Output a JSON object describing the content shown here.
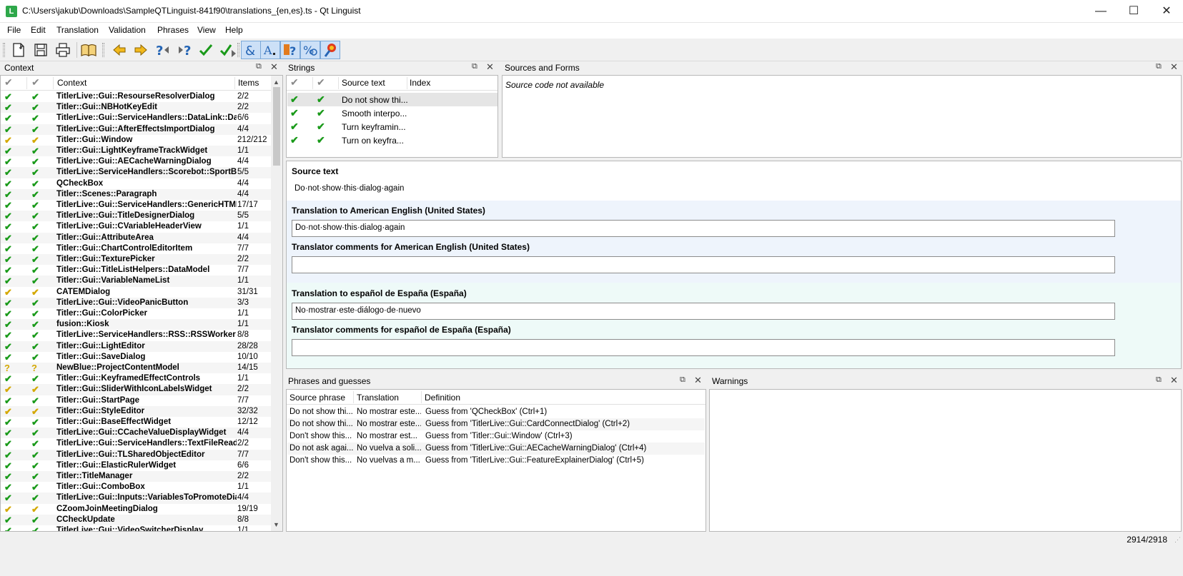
{
  "window": {
    "title": "C:\\Users\\jakub\\Downloads\\SampleQTLinguist-841f90\\translations_{en,es}.ts - Qt Linguist",
    "app_icon_letter": "L",
    "minimize": "—",
    "maximize": "☐",
    "close": "✕"
  },
  "menu": [
    "File",
    "Edit",
    "Translation",
    "Validation",
    "Phrases",
    "View",
    "Help"
  ],
  "toolbar_icons": [
    "open-icon",
    "save-icon",
    "print-icon",
    "phrasebook-icon",
    "prev-icon",
    "next-icon",
    "prev-unfinished-icon",
    "next-unfinished-icon",
    "done-icon",
    "done-and-next-icon",
    "accelerators-icon",
    "ending-punctuation-icon",
    "phrase-matches-icon",
    "place-markers-icon",
    "surrounding-whitespace-icon"
  ],
  "context_panel": {
    "title": "Context",
    "headers": {
      "context": "Context",
      "items": "Items"
    },
    "rows": [
      {
        "name": "TitlerLive::Gui::ResourseResolverDialog",
        "items": "2/2",
        "status": "g"
      },
      {
        "name": "Titler::Gui::NBHotKeyEdit",
        "items": "2/2",
        "status": "g"
      },
      {
        "name": "TitlerLive::Gui::ServiceHandlers::DataLink::Datal",
        "items": "6/6",
        "status": "g"
      },
      {
        "name": "TitlerLive::Gui::AfterEffectsImportDialog",
        "items": "4/4",
        "status": "g"
      },
      {
        "name": "Titler::Gui::Window",
        "items": "212/212",
        "status": "y"
      },
      {
        "name": "Titler::Gui::LightKeyframeTrackWidget",
        "items": "1/1",
        "status": "g"
      },
      {
        "name": "TitlerLive::Gui::AECacheWarningDialog",
        "items": "4/4",
        "status": "g"
      },
      {
        "name": "TitlerLive::ServiceHandlers::Scorebot::SportBot",
        "items": "5/5",
        "status": "g"
      },
      {
        "name": "QCheckBox",
        "items": "4/4",
        "status": "g"
      },
      {
        "name": "Titler::Scenes::Paragraph",
        "items": "4/4",
        "status": "g"
      },
      {
        "name": "TitlerLive::Gui::ServiceHandlers::GenericHTML::",
        "items": "17/17",
        "status": "g"
      },
      {
        "name": "TitlerLive::Gui::TitleDesignerDialog",
        "items": "5/5",
        "status": "g"
      },
      {
        "name": "TitlerLive::Gui::CVariableHeaderView",
        "items": "1/1",
        "status": "g"
      },
      {
        "name": "Titler::Gui::AttributeArea",
        "items": "4/4",
        "status": "g"
      },
      {
        "name": "Titler::Gui::ChartControlEditorItem",
        "items": "7/7",
        "status": "g"
      },
      {
        "name": "Titler::Gui::TexturePicker",
        "items": "2/2",
        "status": "g"
      },
      {
        "name": "Titler::Gui::TitleListHelpers::DataModel",
        "items": "7/7",
        "status": "g"
      },
      {
        "name": "Titler::Gui::VariableNameList",
        "items": "1/1",
        "status": "g"
      },
      {
        "name": "CATEMDialog",
        "items": "31/31",
        "status": "y"
      },
      {
        "name": "TitlerLive::Gui::VideoPanicButton",
        "items": "3/3",
        "status": "g"
      },
      {
        "name": "Titler::Gui::ColorPicker",
        "items": "1/1",
        "status": "g"
      },
      {
        "name": "fusion::Kiosk",
        "items": "1/1",
        "status": "g"
      },
      {
        "name": "TitlerLive::ServiceHandlers::RSS::RSSWorker",
        "items": "8/8",
        "status": "g"
      },
      {
        "name": "Titler::Gui::LightEditor",
        "items": "28/28",
        "status": "g"
      },
      {
        "name": "Titler::Gui::SaveDialog",
        "items": "10/10",
        "status": "g"
      },
      {
        "name": "NewBlue::ProjectContentModel",
        "items": "14/15",
        "status": "q"
      },
      {
        "name": "Titler::Gui::KeyframedEffectControls",
        "items": "1/1",
        "status": "g"
      },
      {
        "name": "Titler::Gui::SliderWithIconLabelsWidget",
        "items": "2/2",
        "status": "y"
      },
      {
        "name": "Titler::Gui::StartPage",
        "items": "7/7",
        "status": "g"
      },
      {
        "name": "Titler::Gui::StyleEditor",
        "items": "32/32",
        "status": "y"
      },
      {
        "name": "Titler::Gui::BaseEffectWidget",
        "items": "12/12",
        "status": "g"
      },
      {
        "name": "TitlerLive::Gui::CCacheValueDisplayWidget",
        "items": "4/4",
        "status": "g"
      },
      {
        "name": "TitlerLive::Gui::ServiceHandlers::TextFileReader",
        "items": "2/2",
        "status": "g"
      },
      {
        "name": "TitlerLive::Gui::TLSharedObjectEditor",
        "items": "7/7",
        "status": "g"
      },
      {
        "name": "Titler::Gui::ElasticRulerWidget",
        "items": "6/6",
        "status": "g"
      },
      {
        "name": "Titler::TitleManager",
        "items": "2/2",
        "status": "g"
      },
      {
        "name": "Titler::Gui::ComboBox",
        "items": "1/1",
        "status": "g"
      },
      {
        "name": "TitlerLive::Gui::Inputs::VariablesToPromoteDialo",
        "items": "4/4",
        "status": "g"
      },
      {
        "name": "CZoomJoinMeetingDialog",
        "items": "19/19",
        "status": "y"
      },
      {
        "name": "CCheckUpdate",
        "items": "8/8",
        "status": "g"
      },
      {
        "name": "TitlerLive::Gui::VideoSwitcherDisplay",
        "items": "1/1",
        "status": "g"
      }
    ]
  },
  "strings_panel": {
    "title": "Strings",
    "headers": {
      "source": "Source text",
      "index": "Index"
    },
    "rows": [
      "Do not show thi...",
      "Smooth interpo...",
      "Turn keyframin...",
      "Turn on keyfra..."
    ]
  },
  "sources_panel": {
    "title": "Sources and Forms",
    "message": "Source code not available"
  },
  "editor": {
    "source_label": "Source text",
    "source_value": "Do·not·show·this·dialog·again",
    "en_label": "Translation to American English (United States)",
    "en_value": "Do·not·show·this·dialog·again",
    "en_comments_label": "Translator comments for American English (United States)",
    "es_label": "Translation to español de España (España)",
    "es_value": "No·mostrar·este·diálogo·de·nuevo",
    "es_comments_label": "Translator comments for español de España (España)"
  },
  "phrases_panel": {
    "title": "Phrases and guesses",
    "headers": {
      "source": "Source phrase",
      "translation": "Translation",
      "definition": "Definition"
    },
    "rows": [
      {
        "source": "Do not show thi...",
        "translation": "No mostrar este...",
        "definition": "Guess from 'QCheckBox' (Ctrl+1)"
      },
      {
        "source": "Do not show thi...",
        "translation": "No mostrar este...",
        "definition": "Guess from 'TitlerLive::Gui::CardConnectDialog' (Ctrl+2)"
      },
      {
        "source": "Don't show this...",
        "translation": "No mostrar est...",
        "definition": "Guess from 'Titler::Gui::Window' (Ctrl+3)"
      },
      {
        "source": "Do not ask agai...",
        "translation": "No vuelva a soli...",
        "definition": "Guess from 'TitlerLive::Gui::AECacheWarningDialog' (Ctrl+4)"
      },
      {
        "source": "Don't show this...",
        "translation": "No vuelvas a m...",
        "definition": "Guess from 'TitlerLive::Gui::FeatureExplainerDialog' (Ctrl+5)"
      }
    ]
  },
  "warnings_panel": {
    "title": "Warnings"
  },
  "status_bar": {
    "count": "2914/2918"
  },
  "colors": {
    "done": "#1a9a1a",
    "warning": "#d4a800",
    "editor_en_bg": "#eef4fc",
    "editor_es_bg": "#eefaf8"
  }
}
